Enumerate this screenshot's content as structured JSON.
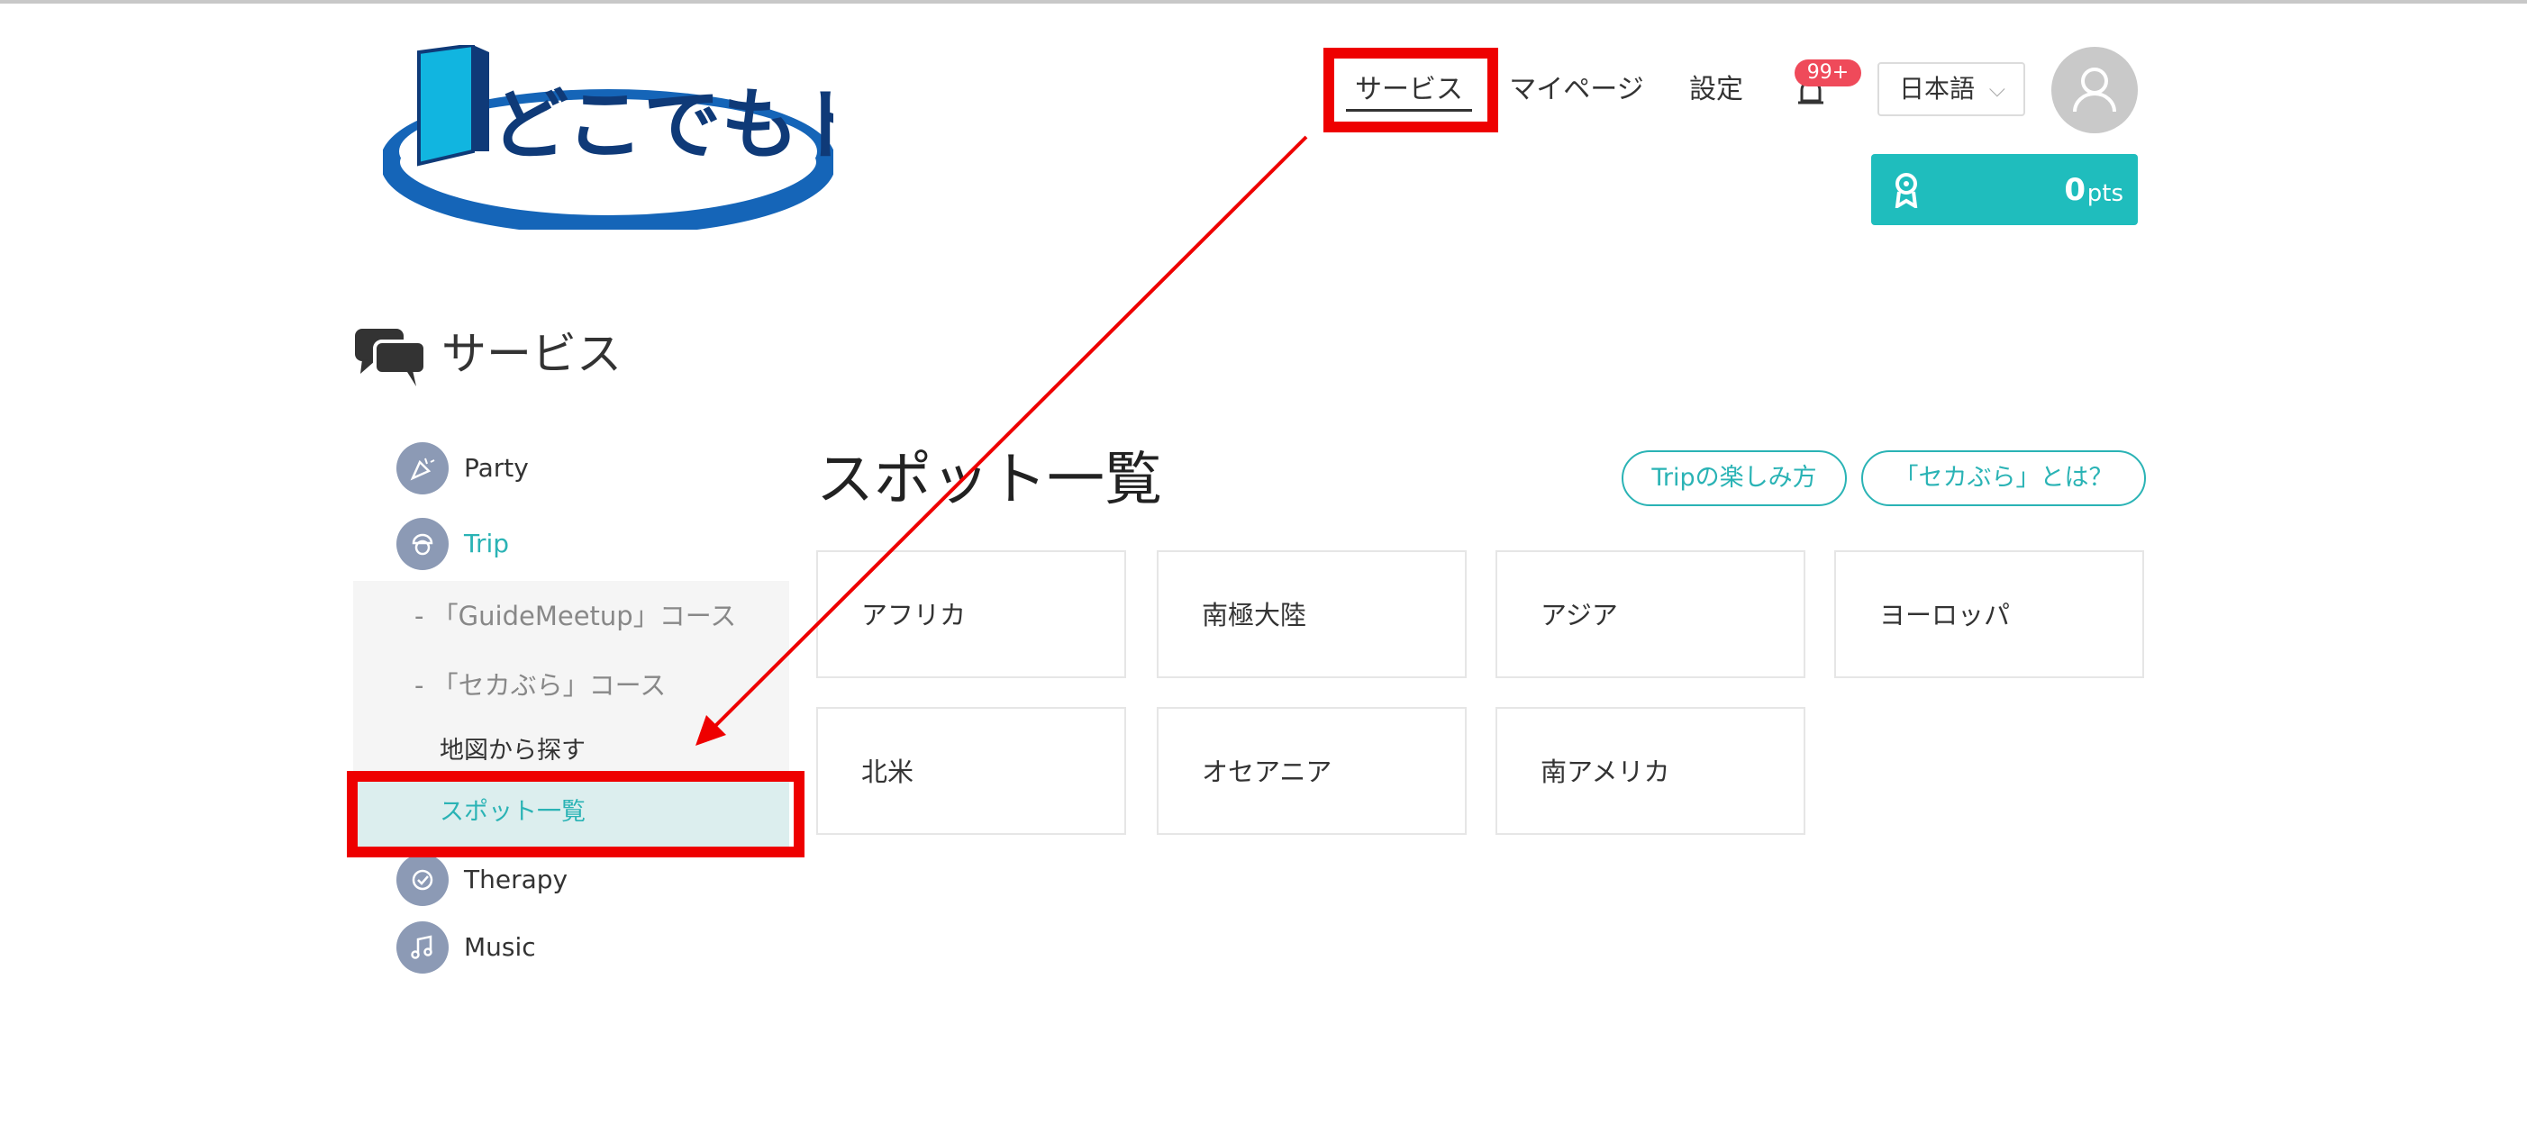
{
  "header": {
    "logo_text": "どこでもドア",
    "nav": {
      "services": "サービス",
      "mypage": "マイページ",
      "settings": "設定"
    },
    "notification_badge": "99+",
    "language": "日本語",
    "points_value": "0",
    "points_unit": "pts"
  },
  "section": {
    "title": "サービス"
  },
  "sidebar": {
    "items": [
      {
        "label": "Party",
        "icon": "party-icon"
      },
      {
        "label": "Trip",
        "icon": "trip-icon"
      },
      {
        "label": "Therapy",
        "icon": "therapy-icon"
      },
      {
        "label": "Music",
        "icon": "music-icon"
      }
    ],
    "trip_sub": [
      {
        "label": "- 「GuideMeetup」コース"
      },
      {
        "label": "- 「セカぶら」コース"
      }
    ],
    "trip_children": [
      {
        "label": "地図から探す"
      },
      {
        "label": "スポット一覧"
      }
    ]
  },
  "main": {
    "title": "スポット一覧",
    "buttons": {
      "trip_guide": "Tripの楽しみ方",
      "sekabura_about": "「セカぶら」とは？"
    },
    "regions": [
      "アフリカ",
      "南極大陸",
      "アジア",
      "ヨーロッパ",
      "北米",
      "オセアニア",
      "南アメリカ"
    ]
  },
  "colors": {
    "accent": "#2ab3b5",
    "points_bg": "#1fbdbd",
    "badge": "#ef4a5a",
    "annotation": "#ee0000",
    "logo_blue": "#1565b8",
    "logo_cyan": "#11b5e0",
    "logo_navy": "#0f3a78"
  }
}
